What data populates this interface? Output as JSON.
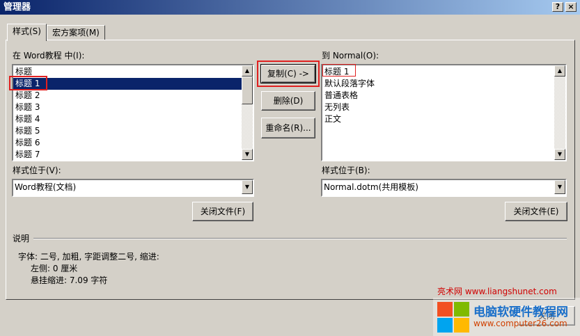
{
  "window": {
    "title": "管理器",
    "help_button": "?",
    "close_button": "×"
  },
  "tabs": [
    {
      "label": "样式(S)"
    },
    {
      "label": "宏方案项(M)"
    }
  ],
  "left": {
    "label": "在 Word教程 中(I):",
    "items": [
      "标题",
      "标题 1",
      "标题 2",
      "标题 3",
      "标题 4",
      "标题 5",
      "标题 6",
      "标题 7"
    ],
    "selected_index": 1,
    "location_label": "样式位于(V):",
    "location_value": "Word教程(文档)",
    "close_file_button": "关闭文件(F)"
  },
  "right": {
    "label": "到 Normal(O):",
    "items": [
      "标题 1",
      "默认段落字体",
      "普通表格",
      "无列表",
      "正文"
    ],
    "location_label": "样式位于(B):",
    "location_value": "Normal.dotm(共用模板)",
    "close_file_button": "关闭文件(E)"
  },
  "actions": {
    "copy": "复制(C) ->",
    "delete": "删除(D)",
    "rename": "重命名(R)..."
  },
  "description": {
    "heading": "说明",
    "line1": "字体: 二号, 加粗, 字距调整二号, 缩进:",
    "line2": "左侧:  0 厘米",
    "line3": "悬挂缩进: 7.09 字符"
  },
  "footer": {
    "close_button": "关闭"
  },
  "watermark": {
    "line1": "亮术网 www.liangshunet.com",
    "brand": "电脑软硬件教程网",
    "url": "www.computer26.com"
  },
  "colors": {
    "titlebar_start": "#0a246a",
    "titlebar_end": "#a6caf0",
    "selection": "#0a246a",
    "highlight_box": "#e02020",
    "dialog_bg": "#d4d0c8"
  }
}
